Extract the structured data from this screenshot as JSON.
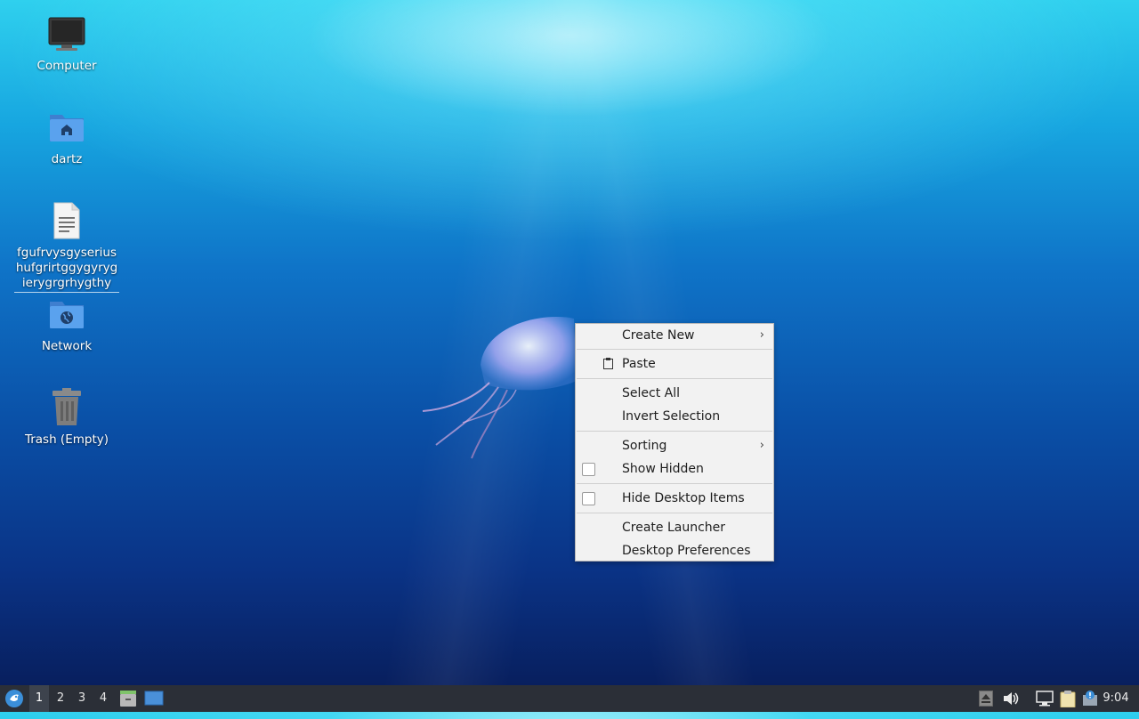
{
  "desktop": {
    "icons": [
      {
        "label": "Computer",
        "icon": "computer-icon"
      },
      {
        "label": "dartz",
        "icon": "home-folder-icon"
      },
      {
        "label": "fgufrvysgyserius hufgrirtggygyryg ierygrgrhygthy",
        "icon": "text-file-icon"
      },
      {
        "label": "Network",
        "icon": "network-folder-icon"
      },
      {
        "label": "Trash (Empty)",
        "icon": "trash-icon"
      }
    ]
  },
  "context_menu": {
    "create_new": "Create New",
    "paste": "Paste",
    "select_all": "Select All",
    "invert_selection": "Invert Selection",
    "sorting": "Sorting",
    "show_hidden": "Show Hidden",
    "hide_desktop_items": "Hide Desktop Items",
    "create_launcher": "Create Launcher",
    "desktop_preferences": "Desktop Preferences",
    "submenu_arrow": "›"
  },
  "taskbar": {
    "workspaces": [
      "1",
      "2",
      "3",
      "4"
    ],
    "active_workspace": "1",
    "clock": "9:04"
  },
  "colors": {
    "taskbar_bg": "#2b2f37",
    "menu_bg": "#f2f2f2",
    "folder_blue": "#4a90d9"
  }
}
